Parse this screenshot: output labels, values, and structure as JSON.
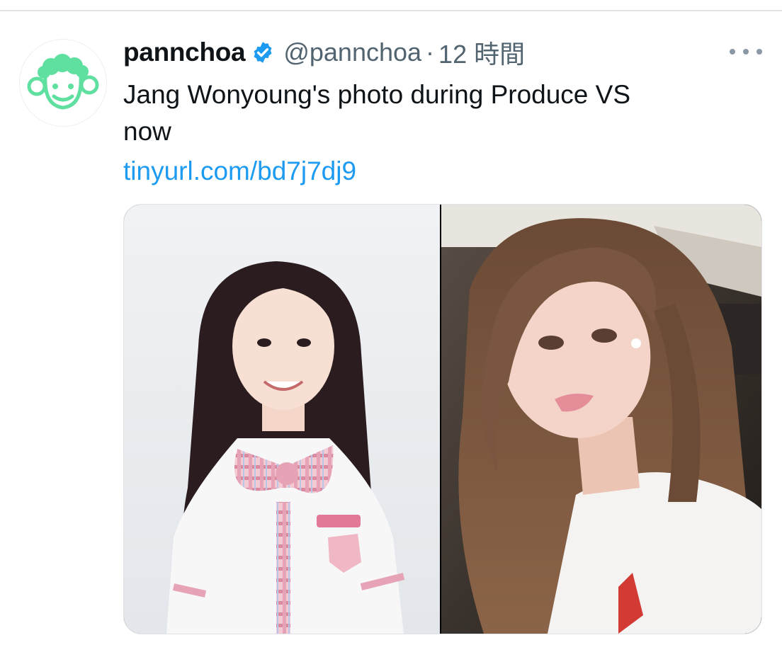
{
  "tweet": {
    "author": {
      "display_name": "pannchoa",
      "handle": "@pannchoa",
      "verified": true,
      "avatar_icon": "mint-sheep-face-icon"
    },
    "separator": "·",
    "timestamp": "12 時間",
    "text_lines": [
      "Jang Wonyoung's photo during Produce VS",
      "now"
    ],
    "link": "tinyurl.com/bd7j7dj9",
    "more_icon": "more-horizontal-icon"
  },
  "colors": {
    "text_primary": "#0f1419",
    "text_secondary": "#536471",
    "link": "#1d9bf0",
    "verified_badge": "#1d9bf0",
    "avatar_accent": "#5fe0a0"
  }
}
